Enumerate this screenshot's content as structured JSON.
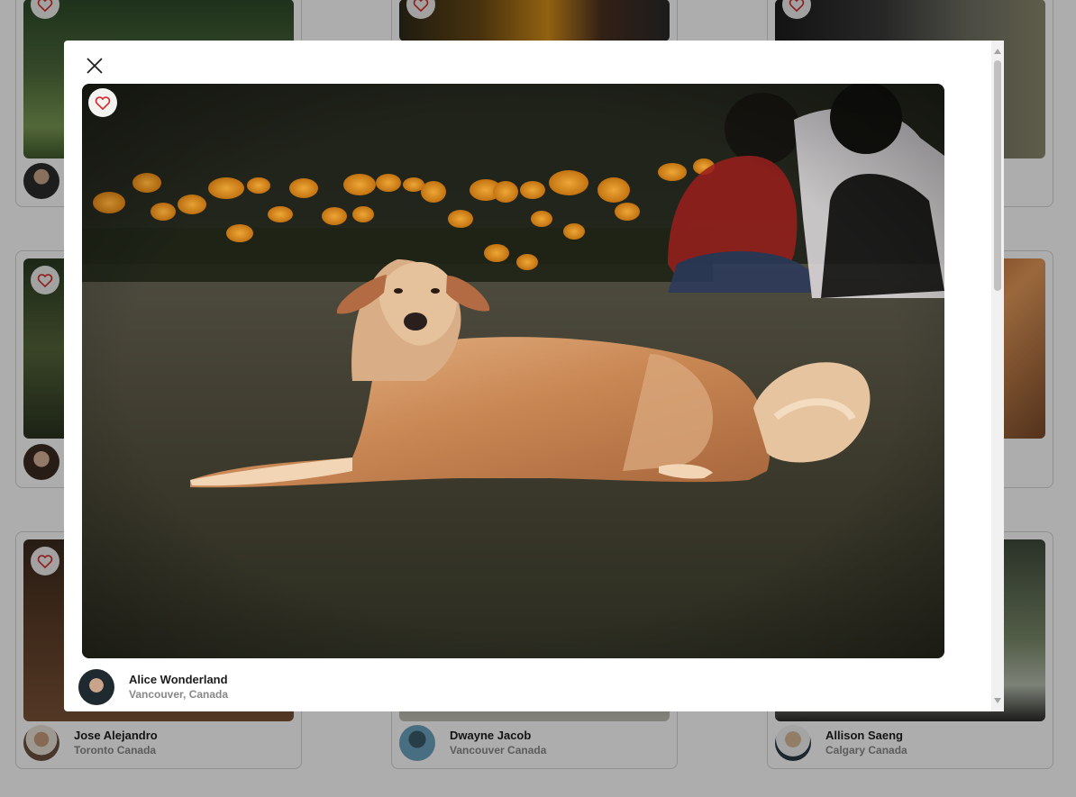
{
  "grid": {
    "cards": [
      {
        "author_name": "",
        "author_location": ""
      },
      {
        "author_name": "",
        "author_location": ""
      },
      {
        "author_name": "",
        "author_location": ""
      },
      {
        "author_name": "",
        "author_location": ""
      },
      {
        "author_name": "",
        "author_location": ""
      },
      {
        "author_name": "Jose Alejandro",
        "author_location": "Toronto Canada"
      },
      {
        "author_name": "Dwayne Jacob",
        "author_location": "Vancouver Canada"
      },
      {
        "author_name": "Allison Saeng",
        "author_location": "Calgary Canada"
      }
    ]
  },
  "modal": {
    "author_name": "Alice Wonderland",
    "author_location": "Vancouver, Canada"
  },
  "icons": {
    "close": "close-icon",
    "favorite": "heart-outline-icon"
  },
  "colors": {
    "heart": "#d62b2b",
    "overlay": "rgba(0,0,0,0.32)",
    "text_primary": "#1c1c1c",
    "text_secondary": "#888888"
  }
}
